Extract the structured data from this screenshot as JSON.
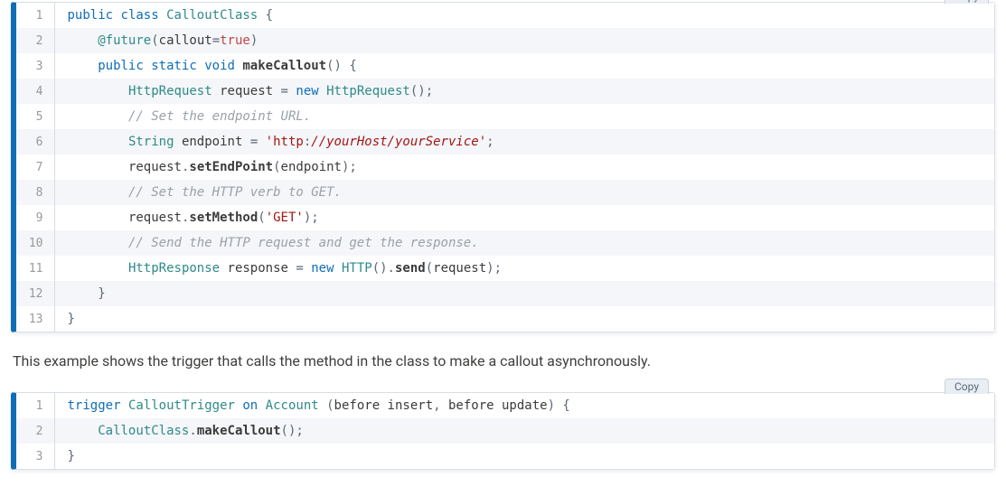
{
  "copyLabel": "Copy",
  "paragraph": "This example shows the trigger that calls the method in the class to make a callout asynchronously.",
  "block1": {
    "lines": [
      {
        "n": "1",
        "tokens": [
          {
            "t": "public ",
            "c": "tok-kw"
          },
          {
            "t": "class ",
            "c": "tok-kw"
          },
          {
            "t": "CalloutClass ",
            "c": "tok-type"
          },
          {
            "t": "{",
            "c": "tok-punc"
          }
        ]
      },
      {
        "n": "2",
        "tokens": [
          {
            "t": "    ",
            "c": ""
          },
          {
            "t": "@future",
            "c": "tok-ann"
          },
          {
            "t": "(",
            "c": "tok-punc"
          },
          {
            "t": "callout",
            "c": "tok-var"
          },
          {
            "t": "=",
            "c": "tok-op"
          },
          {
            "t": "true",
            "c": "tok-true"
          },
          {
            "t": ")",
            "c": "tok-punc"
          }
        ]
      },
      {
        "n": "3",
        "tokens": [
          {
            "t": "    ",
            "c": ""
          },
          {
            "t": "public static void ",
            "c": "tok-kw"
          },
          {
            "t": "makeCallout",
            "c": "tok-method"
          },
          {
            "t": "()",
            "c": "tok-punc"
          },
          {
            "t": " {",
            "c": "tok-punc"
          }
        ]
      },
      {
        "n": "4",
        "tokens": [
          {
            "t": "        ",
            "c": ""
          },
          {
            "t": "HttpRequest ",
            "c": "tok-type"
          },
          {
            "t": "request ",
            "c": "tok-var"
          },
          {
            "t": "=",
            "c": "tok-op"
          },
          {
            "t": " new ",
            "c": "tok-kw"
          },
          {
            "t": "HttpRequest",
            "c": "tok-type"
          },
          {
            "t": "();",
            "c": "tok-punc"
          }
        ]
      },
      {
        "n": "5",
        "tokens": [
          {
            "t": "        ",
            "c": ""
          },
          {
            "t": "// Set the endpoint URL.",
            "c": "tok-comment"
          }
        ]
      },
      {
        "n": "6",
        "tokens": [
          {
            "t": "        ",
            "c": ""
          },
          {
            "t": "String ",
            "c": "tok-type"
          },
          {
            "t": "endpoint ",
            "c": "tok-var"
          },
          {
            "t": "=",
            "c": "tok-op"
          },
          {
            "t": " 'http",
            "c": "tok-str"
          },
          {
            "t": ":",
            "c": "tok-punc"
          },
          {
            "t": "//yourHost/yourService'",
            "c": "tok-str-i"
          },
          {
            "t": ";",
            "c": "tok-punc"
          }
        ]
      },
      {
        "n": "7",
        "tokens": [
          {
            "t": "        ",
            "c": ""
          },
          {
            "t": "request",
            "c": "tok-var"
          },
          {
            "t": ".",
            "c": "tok-punc"
          },
          {
            "t": "setEndPoint",
            "c": "tok-method"
          },
          {
            "t": "(",
            "c": "tok-punc"
          },
          {
            "t": "endpoint",
            "c": "tok-var"
          },
          {
            "t": ");",
            "c": "tok-punc"
          }
        ]
      },
      {
        "n": "8",
        "tokens": [
          {
            "t": "        ",
            "c": ""
          },
          {
            "t": "// Set the HTTP verb to GET.",
            "c": "tok-comment"
          }
        ]
      },
      {
        "n": "9",
        "tokens": [
          {
            "t": "        ",
            "c": ""
          },
          {
            "t": "request",
            "c": "tok-var"
          },
          {
            "t": ".",
            "c": "tok-punc"
          },
          {
            "t": "setMethod",
            "c": "tok-method"
          },
          {
            "t": "(",
            "c": "tok-punc"
          },
          {
            "t": "'GET'",
            "c": "tok-str"
          },
          {
            "t": ");",
            "c": "tok-punc"
          }
        ]
      },
      {
        "n": "10",
        "tokens": [
          {
            "t": "        ",
            "c": ""
          },
          {
            "t": "// Send the HTTP request and get the response.",
            "c": "tok-comment"
          }
        ]
      },
      {
        "n": "11",
        "tokens": [
          {
            "t": "        ",
            "c": ""
          },
          {
            "t": "HttpResponse ",
            "c": "tok-type"
          },
          {
            "t": "response ",
            "c": "tok-var"
          },
          {
            "t": "=",
            "c": "tok-op"
          },
          {
            "t": " new ",
            "c": "tok-kw"
          },
          {
            "t": "HTTP",
            "c": "tok-type"
          },
          {
            "t": "().",
            "c": "tok-punc"
          },
          {
            "t": "send",
            "c": "tok-method"
          },
          {
            "t": "(",
            "c": "tok-punc"
          },
          {
            "t": "request",
            "c": "tok-var"
          },
          {
            "t": ");",
            "c": "tok-punc"
          }
        ]
      },
      {
        "n": "12",
        "tokens": [
          {
            "t": "    }",
            "c": "tok-punc"
          }
        ]
      },
      {
        "n": "13",
        "tokens": [
          {
            "t": "}",
            "c": "tok-punc"
          }
        ]
      }
    ]
  },
  "block2": {
    "lines": [
      {
        "n": "1",
        "tokens": [
          {
            "t": "trigger ",
            "c": "tok-kw"
          },
          {
            "t": "CalloutTrigger ",
            "c": "tok-type"
          },
          {
            "t": "on ",
            "c": "tok-kw"
          },
          {
            "t": "Account ",
            "c": "tok-type"
          },
          {
            "t": "(",
            "c": "tok-punc"
          },
          {
            "t": "before insert",
            "c": "tok-var"
          },
          {
            "t": ", ",
            "c": "tok-punc"
          },
          {
            "t": "before update",
            "c": "tok-var"
          },
          {
            "t": ") {",
            "c": "tok-punc"
          }
        ]
      },
      {
        "n": "2",
        "tokens": [
          {
            "t": "    ",
            "c": ""
          },
          {
            "t": "CalloutClass",
            "c": "tok-type"
          },
          {
            "t": ".",
            "c": "tok-punc"
          },
          {
            "t": "makeCallout",
            "c": "tok-method"
          },
          {
            "t": "();",
            "c": "tok-punc"
          }
        ]
      },
      {
        "n": "3",
        "tokens": [
          {
            "t": "}",
            "c": "tok-punc"
          }
        ]
      }
    ]
  }
}
